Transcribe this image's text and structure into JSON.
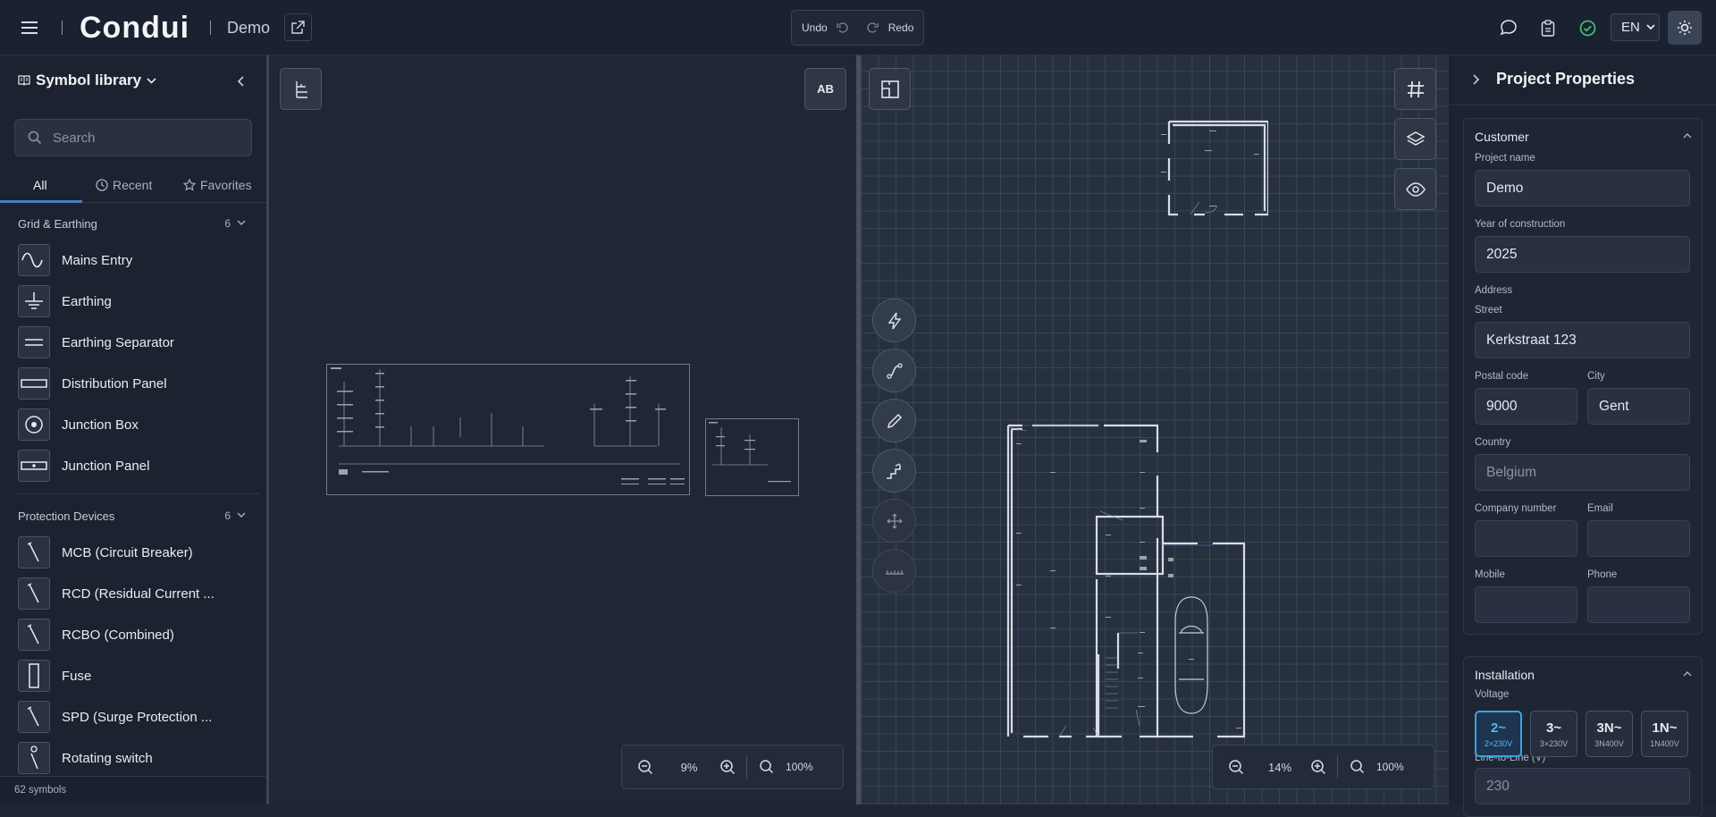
{
  "app": {
    "logo": "Condui",
    "project_name": "Demo"
  },
  "toolbar": {
    "undo_label": "Undo",
    "redo_label": "Redo",
    "language": "EN"
  },
  "sidebar": {
    "title": "Symbol library",
    "search_placeholder": "Search",
    "tabs": [
      {
        "label": "All"
      },
      {
        "label": "Recent"
      },
      {
        "label": "Favorites"
      }
    ],
    "categories": [
      {
        "name": "Grid & Earthing",
        "count": "6",
        "items": [
          {
            "label": "Mains Entry"
          },
          {
            "label": "Earthing"
          },
          {
            "label": "Earthing Separator"
          },
          {
            "label": "Distribution Panel"
          },
          {
            "label": "Junction Box"
          },
          {
            "label": "Junction Panel"
          }
        ]
      },
      {
        "name": "Protection Devices",
        "count": "6",
        "items": [
          {
            "label": "MCB (Circuit Breaker)"
          },
          {
            "label": "RCD (Residual Current ..."
          },
          {
            "label": "RCBO (Combined)"
          },
          {
            "label": "Fuse"
          },
          {
            "label": "SPD (Surge Protection ..."
          },
          {
            "label": "Rotating switch"
          }
        ]
      }
    ],
    "footer": "62 symbols"
  },
  "schematic": {
    "zoom": "9%",
    "reset": "100%",
    "ab_label": "AB"
  },
  "floorplan": {
    "zoom": "14%",
    "reset": "100%"
  },
  "properties": {
    "title": "Project Properties",
    "customer": {
      "header": "Customer",
      "project_name_label": "Project name",
      "project_name": "Demo",
      "year_label": "Year of construction",
      "year": "2025",
      "address_label": "Address",
      "street_label": "Street",
      "street": "Kerkstraat 123",
      "postal_label": "Postal code",
      "postal": "9000",
      "city_label": "City",
      "city": "Gent",
      "country_label": "Country",
      "country_placeholder": "Belgium",
      "company_label": "Company number",
      "email_label": "Email",
      "mobile_label": "Mobile",
      "phone_label": "Phone"
    },
    "installation": {
      "header": "Installation",
      "voltage_label": "Voltage",
      "voltages": [
        {
          "main": "2~",
          "sub": "2×230V",
          "selected": true
        },
        {
          "main": "3~",
          "sub": "3×230V"
        },
        {
          "main": "3N~",
          "sub": "3N400V"
        },
        {
          "main": "1N~",
          "sub": "1N400V"
        }
      ],
      "line_label": "Line-to-Line (V)",
      "line_value": "230"
    }
  },
  "colors": {
    "accent": "#3aa5e0",
    "status_ok": "#3fbf6a",
    "bg": "#1e2533"
  }
}
